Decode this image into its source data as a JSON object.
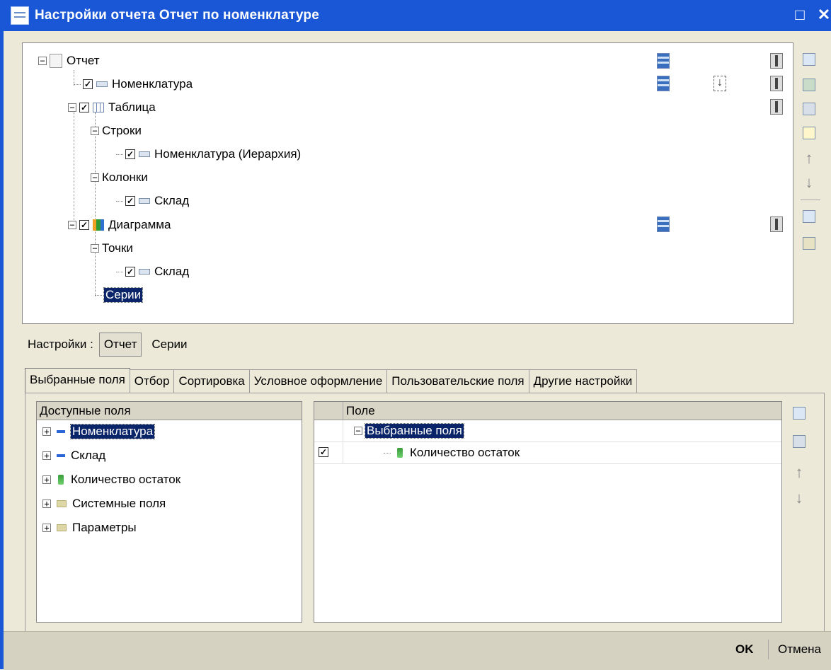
{
  "window": {
    "title": "Настройки отчета  Отчет по номенклатуре",
    "maximize_glyph": "□",
    "close_glyph": "✕"
  },
  "tree": {
    "root": "Отчет",
    "nomenclature": "Номенклатура",
    "table": "Таблица",
    "rows": "Строки",
    "nomenclature_hier": "Номенклатура (Иерархия)",
    "columns": "Колонки",
    "warehouse_col": "Склад",
    "chart": "Диаграмма",
    "points": "Точки",
    "warehouse_pt": "Склад",
    "series": "Серии"
  },
  "settings": {
    "label": "Настройки :",
    "report_btn": "Отчет",
    "series_btn": "Серии"
  },
  "tabs": [
    {
      "label": "Выбранные поля"
    },
    {
      "label": "Отбор"
    },
    {
      "label": "Сортировка"
    },
    {
      "label": "Условное оформление"
    },
    {
      "label": "Пользовательские поля"
    },
    {
      "label": "Другие настройки"
    }
  ],
  "available_fields": {
    "header": "Доступные поля",
    "items": [
      {
        "label": "Номенклатура"
      },
      {
        "label": "Склад"
      },
      {
        "label": "Количество остаток"
      },
      {
        "label": "Системные поля"
      },
      {
        "label": "Параметры"
      }
    ]
  },
  "selected_fields": {
    "header": "Поле",
    "group": "Выбранные поля",
    "item": "Количество остаток"
  },
  "footer": {
    "ok": "OK",
    "cancel": "Отмена"
  },
  "colors": {
    "titlebar": "#1a57d6",
    "selection": "#0a246a",
    "face": "#ece9d8"
  }
}
